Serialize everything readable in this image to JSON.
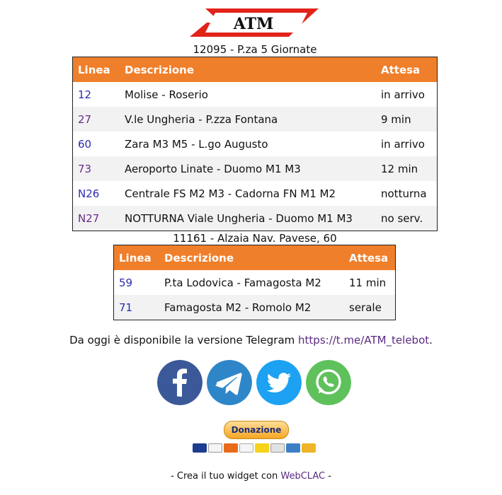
{
  "logo": {
    "text": "ATM",
    "accent": "#e2231a"
  },
  "stops": [
    {
      "title": "12095 - P.za 5 Giornate",
      "headers": {
        "line": "Linea",
        "desc": "Descrizione",
        "wait": "Attesa"
      },
      "rows": [
        {
          "line": "12",
          "desc": "Molise - Roserio",
          "wait": "in arrivo"
        },
        {
          "line": "27",
          "desc": "V.le Ungheria - P.zza Fontana",
          "wait": "9 min"
        },
        {
          "line": "60",
          "desc": "Zara M3 M5 - L.go Augusto",
          "wait": "in arrivo"
        },
        {
          "line": "73",
          "desc": "Aeroporto Linate - Duomo M1 M3",
          "wait": "12 min"
        },
        {
          "line": "N26",
          "desc": "Centrale FS M2 M3 - Cadorna FN M1 M2",
          "wait": "notturna"
        },
        {
          "line": "N27",
          "desc": "NOTTURNA Viale Ungheria - Duomo M1 M3",
          "wait": "no serv."
        }
      ]
    },
    {
      "title": "11161 - Alzaia Nav. Pavese, 60",
      "headers": {
        "line": "Linea",
        "desc": "Descrizione",
        "wait": "Attesa"
      },
      "rows": [
        {
          "line": "59",
          "desc": "P.ta Lodovica - Famagosta M2",
          "wait": "11 min"
        },
        {
          "line": "71",
          "desc": "Famagosta M2 - Romolo M2",
          "wait": "serale"
        }
      ]
    }
  ],
  "telegram": {
    "text": "Da oggi è disponibile la versione Telegram ",
    "link": "https://t.me/ATM_telebot",
    "after": "."
  },
  "social": [
    {
      "name": "facebook",
      "icon": "facebook-icon",
      "color": "#3b5998"
    },
    {
      "name": "telegram",
      "icon": "telegram-icon",
      "color": "#2e86c8"
    },
    {
      "name": "twitter",
      "icon": "twitter-icon",
      "color": "#1da1f2"
    },
    {
      "name": "whatsapp",
      "icon": "whatsapp-icon",
      "color": "#5fc15c"
    }
  ],
  "donate": {
    "label": "Donazione"
  },
  "payment_cards": [
    "Maestro",
    "VISA",
    "Mastercard",
    "PayPal",
    "PostePay",
    "Discover",
    "Amex",
    "Bank"
  ],
  "footer": {
    "prefix": "- Crea il tuo widget con ",
    "link": "WebCLAC",
    "suffix": " -"
  },
  "colors": {
    "header_orange": "#f07f2b",
    "link_blue": "#2b2bb0",
    "link_visited": "#6b2c8a"
  }
}
